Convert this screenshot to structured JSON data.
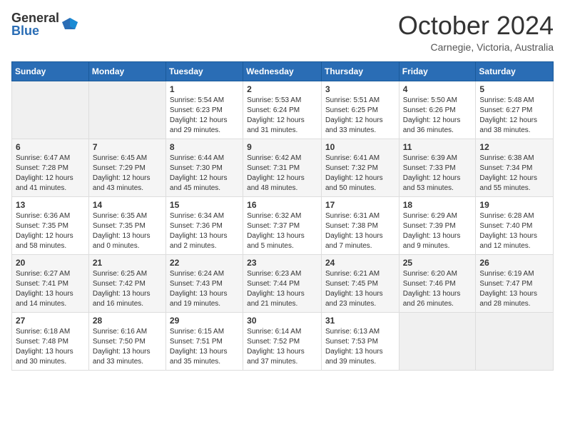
{
  "header": {
    "logo_general": "General",
    "logo_blue": "Blue",
    "month_title": "October 2024",
    "subtitle": "Carnegie, Victoria, Australia"
  },
  "days_of_week": [
    "Sunday",
    "Monday",
    "Tuesday",
    "Wednesday",
    "Thursday",
    "Friday",
    "Saturday"
  ],
  "weeks": [
    [
      {
        "day": "",
        "info": ""
      },
      {
        "day": "",
        "info": ""
      },
      {
        "day": "1",
        "info": "Sunrise: 5:54 AM\nSunset: 6:23 PM\nDaylight: 12 hours and 29 minutes."
      },
      {
        "day": "2",
        "info": "Sunrise: 5:53 AM\nSunset: 6:24 PM\nDaylight: 12 hours and 31 minutes."
      },
      {
        "day": "3",
        "info": "Sunrise: 5:51 AM\nSunset: 6:25 PM\nDaylight: 12 hours and 33 minutes."
      },
      {
        "day": "4",
        "info": "Sunrise: 5:50 AM\nSunset: 6:26 PM\nDaylight: 12 hours and 36 minutes."
      },
      {
        "day": "5",
        "info": "Sunrise: 5:48 AM\nSunset: 6:27 PM\nDaylight: 12 hours and 38 minutes."
      }
    ],
    [
      {
        "day": "6",
        "info": "Sunrise: 6:47 AM\nSunset: 7:28 PM\nDaylight: 12 hours and 41 minutes."
      },
      {
        "day": "7",
        "info": "Sunrise: 6:45 AM\nSunset: 7:29 PM\nDaylight: 12 hours and 43 minutes."
      },
      {
        "day": "8",
        "info": "Sunrise: 6:44 AM\nSunset: 7:30 PM\nDaylight: 12 hours and 45 minutes."
      },
      {
        "day": "9",
        "info": "Sunrise: 6:42 AM\nSunset: 7:31 PM\nDaylight: 12 hours and 48 minutes."
      },
      {
        "day": "10",
        "info": "Sunrise: 6:41 AM\nSunset: 7:32 PM\nDaylight: 12 hours and 50 minutes."
      },
      {
        "day": "11",
        "info": "Sunrise: 6:39 AM\nSunset: 7:33 PM\nDaylight: 12 hours and 53 minutes."
      },
      {
        "day": "12",
        "info": "Sunrise: 6:38 AM\nSunset: 7:34 PM\nDaylight: 12 hours and 55 minutes."
      }
    ],
    [
      {
        "day": "13",
        "info": "Sunrise: 6:36 AM\nSunset: 7:35 PM\nDaylight: 12 hours and 58 minutes."
      },
      {
        "day": "14",
        "info": "Sunrise: 6:35 AM\nSunset: 7:35 PM\nDaylight: 13 hours and 0 minutes."
      },
      {
        "day": "15",
        "info": "Sunrise: 6:34 AM\nSunset: 7:36 PM\nDaylight: 13 hours and 2 minutes."
      },
      {
        "day": "16",
        "info": "Sunrise: 6:32 AM\nSunset: 7:37 PM\nDaylight: 13 hours and 5 minutes."
      },
      {
        "day": "17",
        "info": "Sunrise: 6:31 AM\nSunset: 7:38 PM\nDaylight: 13 hours and 7 minutes."
      },
      {
        "day": "18",
        "info": "Sunrise: 6:29 AM\nSunset: 7:39 PM\nDaylight: 13 hours and 9 minutes."
      },
      {
        "day": "19",
        "info": "Sunrise: 6:28 AM\nSunset: 7:40 PM\nDaylight: 13 hours and 12 minutes."
      }
    ],
    [
      {
        "day": "20",
        "info": "Sunrise: 6:27 AM\nSunset: 7:41 PM\nDaylight: 13 hours and 14 minutes."
      },
      {
        "day": "21",
        "info": "Sunrise: 6:25 AM\nSunset: 7:42 PM\nDaylight: 13 hours and 16 minutes."
      },
      {
        "day": "22",
        "info": "Sunrise: 6:24 AM\nSunset: 7:43 PM\nDaylight: 13 hours and 19 minutes."
      },
      {
        "day": "23",
        "info": "Sunrise: 6:23 AM\nSunset: 7:44 PM\nDaylight: 13 hours and 21 minutes."
      },
      {
        "day": "24",
        "info": "Sunrise: 6:21 AM\nSunset: 7:45 PM\nDaylight: 13 hours and 23 minutes."
      },
      {
        "day": "25",
        "info": "Sunrise: 6:20 AM\nSunset: 7:46 PM\nDaylight: 13 hours and 26 minutes."
      },
      {
        "day": "26",
        "info": "Sunrise: 6:19 AM\nSunset: 7:47 PM\nDaylight: 13 hours and 28 minutes."
      }
    ],
    [
      {
        "day": "27",
        "info": "Sunrise: 6:18 AM\nSunset: 7:48 PM\nDaylight: 13 hours and 30 minutes."
      },
      {
        "day": "28",
        "info": "Sunrise: 6:16 AM\nSunset: 7:50 PM\nDaylight: 13 hours and 33 minutes."
      },
      {
        "day": "29",
        "info": "Sunrise: 6:15 AM\nSunset: 7:51 PM\nDaylight: 13 hours and 35 minutes."
      },
      {
        "day": "30",
        "info": "Sunrise: 6:14 AM\nSunset: 7:52 PM\nDaylight: 13 hours and 37 minutes."
      },
      {
        "day": "31",
        "info": "Sunrise: 6:13 AM\nSunset: 7:53 PM\nDaylight: 13 hours and 39 minutes."
      },
      {
        "day": "",
        "info": ""
      },
      {
        "day": "",
        "info": ""
      }
    ]
  ]
}
